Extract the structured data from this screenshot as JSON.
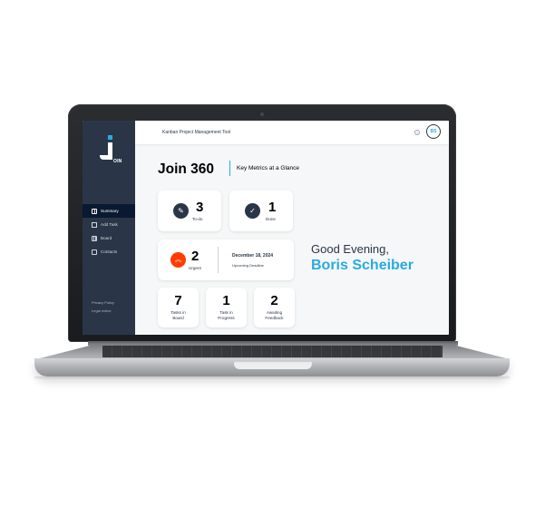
{
  "header": {
    "title": "Kanban Project Management Tool",
    "help_glyph": "?",
    "avatar_initials": "BS"
  },
  "sidebar": {
    "logo_text": "OIN",
    "items": [
      {
        "label": "Summary",
        "icon": "summary-icon",
        "active": true
      },
      {
        "label": "Add Task",
        "icon": "add-task-icon",
        "active": false
      },
      {
        "label": "Board",
        "icon": "board-icon",
        "active": false
      },
      {
        "label": "Contacts",
        "icon": "contacts-icon",
        "active": false
      }
    ],
    "privacy": "Privacy Policy",
    "legal": "Legal notice"
  },
  "main": {
    "title": "Join 360",
    "subtitle": "Key Metrics at a Glance",
    "todo": {
      "count": "3",
      "label": "To-do",
      "icon": "pencil-icon"
    },
    "done": {
      "count": "1",
      "label": "Done",
      "icon": "check-icon"
    },
    "urgent": {
      "count": "2",
      "label": "Urgent",
      "icon": "urgent-arrows-icon",
      "date": "December 18, 2024",
      "deadline_label": "Upcoming Deadline"
    },
    "board": {
      "count": "7",
      "label": "Tasks in Board"
    },
    "progress": {
      "count": "1",
      "label": "Task in Progress"
    },
    "feedback": {
      "count": "2",
      "label": "Awaiting Feedback"
    },
    "greeting": "Good Evening,",
    "user_name": "Boris Scheiber"
  },
  "colors": {
    "sidebar": "#2a3647",
    "accent": "#29abe2",
    "urgent": "#ff3d00"
  }
}
